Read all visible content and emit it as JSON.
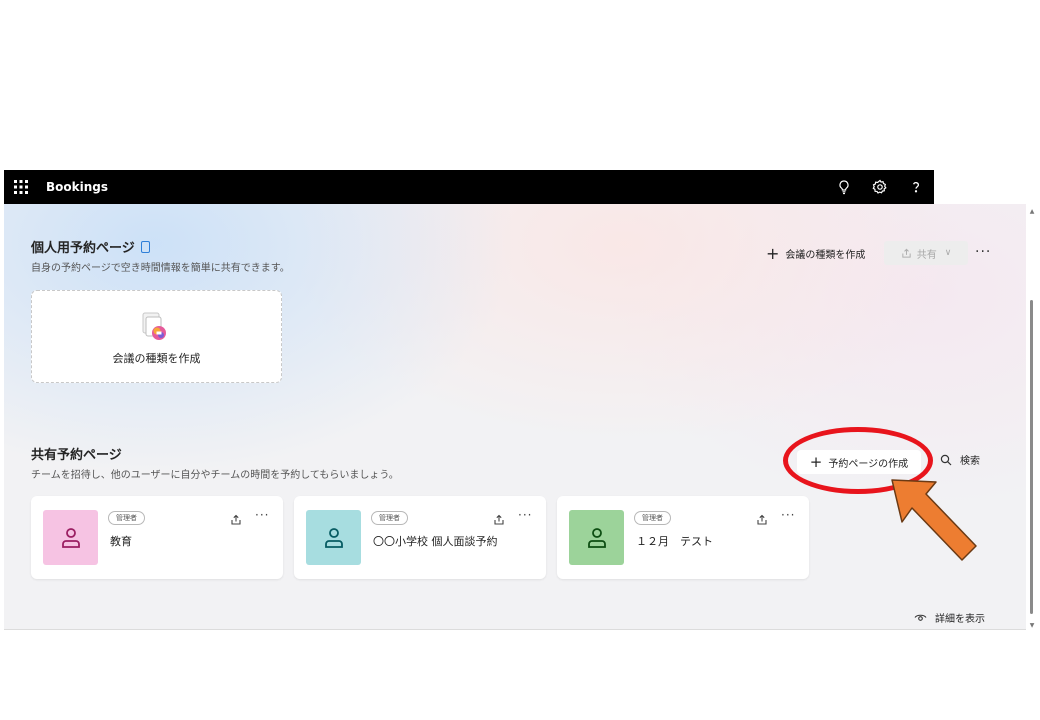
{
  "topbar": {
    "app_name": "Bookings"
  },
  "personal": {
    "title": "個人用予約ページ",
    "subtitle": "自身の予約ページで空き時間情報を簡単に共有できます。",
    "create_meeting_type": "会議の種類を作成",
    "share": "共有",
    "more": "···",
    "card_label": "会議の種類を作成"
  },
  "shared": {
    "title": "共有予約ページ",
    "subtitle": "チームを招待し、他のユーザーに自分やチームの時間を予約してもらいましょう。",
    "create_page": "予約ページの作成",
    "search": "検索",
    "cards": [
      {
        "badge": "管理者",
        "name": "教育",
        "thumb_color": "#f6c3e3",
        "icon_color": "#9b1e62"
      },
      {
        "badge": "管理者",
        "name": "〇〇小学校 個人面談予約",
        "thumb_color": "#a7dde0",
        "icon_color": "#075c63"
      },
      {
        "badge": "管理者",
        "name": "１２月　テスト",
        "thumb_color": "#9cd39a",
        "icon_color": "#0d4e12"
      }
    ],
    "card_more": "···"
  },
  "footer": {
    "show_details": "詳細を表示"
  },
  "annotation": {
    "ellipse_color": "#e8141c",
    "arrow_color": "#ed7d31"
  }
}
